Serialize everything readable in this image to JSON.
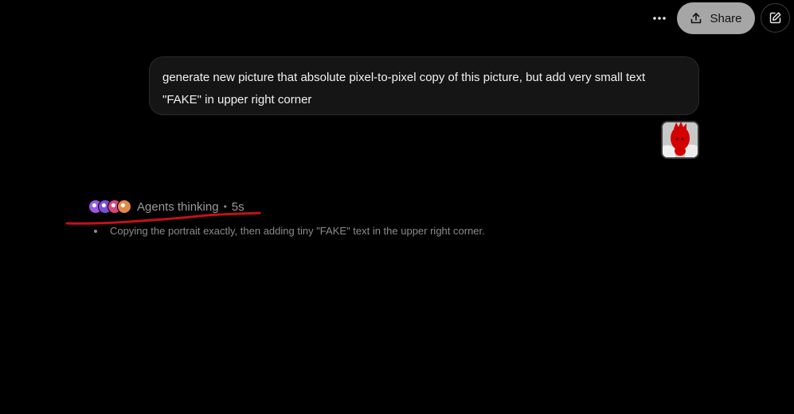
{
  "header": {
    "more_icon": "more-horizontal-icon",
    "share_icon": "share-upload-icon",
    "share_label": "Share",
    "edit_icon": "new-chat-edit-icon"
  },
  "user_message": {
    "text": "generate new picture that absolute pixel-to-pixel copy of this picture, but add very small text \"FAKE\" in upper right corner",
    "attachment_icon": "image-attachment-thumbnail"
  },
  "agents": {
    "label": "Agents thinking",
    "separator": "•",
    "duration": "5s",
    "avatar_colors": [
      "#9b59e0",
      "#7a4fd8",
      "#d6457a",
      "#e0884a"
    ],
    "items": [
      "Copying the portrait exactly, then adding tiny \"FAKE\" text in the upper right corner."
    ]
  },
  "colors": {
    "background": "#000000",
    "share_button": "#a6a6a6",
    "bubble": "#151515",
    "annotation_red": "#c4111a"
  }
}
